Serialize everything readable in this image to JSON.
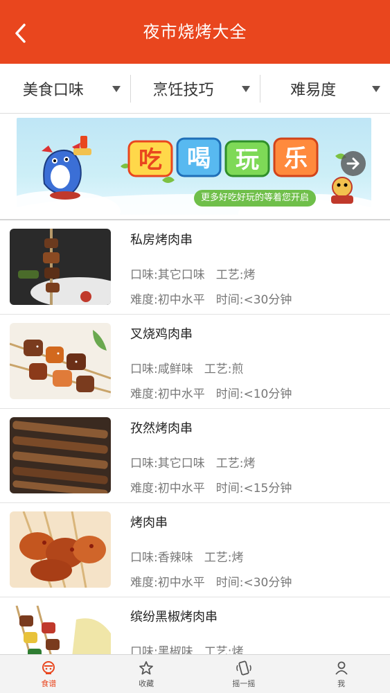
{
  "header": {
    "title": "夜市烧烤大全"
  },
  "filters": [
    {
      "label": "美食口味"
    },
    {
      "label": "烹饪技巧"
    },
    {
      "label": "难易度"
    }
  ],
  "banner": {
    "headline_glyphs": [
      "吃",
      "喝",
      "玩",
      "乐"
    ],
    "tagline": "更多好吃好玩的等着您开启"
  },
  "recipes": [
    {
      "name": "私房烤肉串",
      "taste": "口味:其它口味",
      "craft": "工艺:烤",
      "difficulty": "难度:初中水平",
      "time": "时间:<30分钟"
    },
    {
      "name": "叉烧鸡肉串",
      "taste": "口味:咸鲜味",
      "craft": "工艺:煎",
      "difficulty": "难度:初中水平",
      "time": "时间:<10分钟"
    },
    {
      "name": "孜然烤肉串",
      "taste": "口味:其它口味",
      "craft": "工艺:烤",
      "difficulty": "难度:初中水平",
      "time": "时间:<15分钟"
    },
    {
      "name": "烤肉串",
      "taste": "口味:香辣味",
      "craft": "工艺:烤",
      "difficulty": "难度:初中水平",
      "time": "时间:<30分钟"
    },
    {
      "name": "缤纷黑椒烤肉串",
      "taste": "口味:黑椒味",
      "craft": "工艺:烤",
      "difficulty": "",
      "time": ""
    }
  ],
  "tabbar": [
    {
      "label": "食谱",
      "icon": "chef-hat-icon",
      "active": true
    },
    {
      "label": "收藏",
      "icon": "star-icon",
      "active": false
    },
    {
      "label": "摇一摇",
      "icon": "shake-icon",
      "active": false
    },
    {
      "label": "我",
      "icon": "person-icon",
      "active": false
    }
  ],
  "colors": {
    "brand": "#e9461e",
    "banner_green": "#6fbf4a"
  }
}
